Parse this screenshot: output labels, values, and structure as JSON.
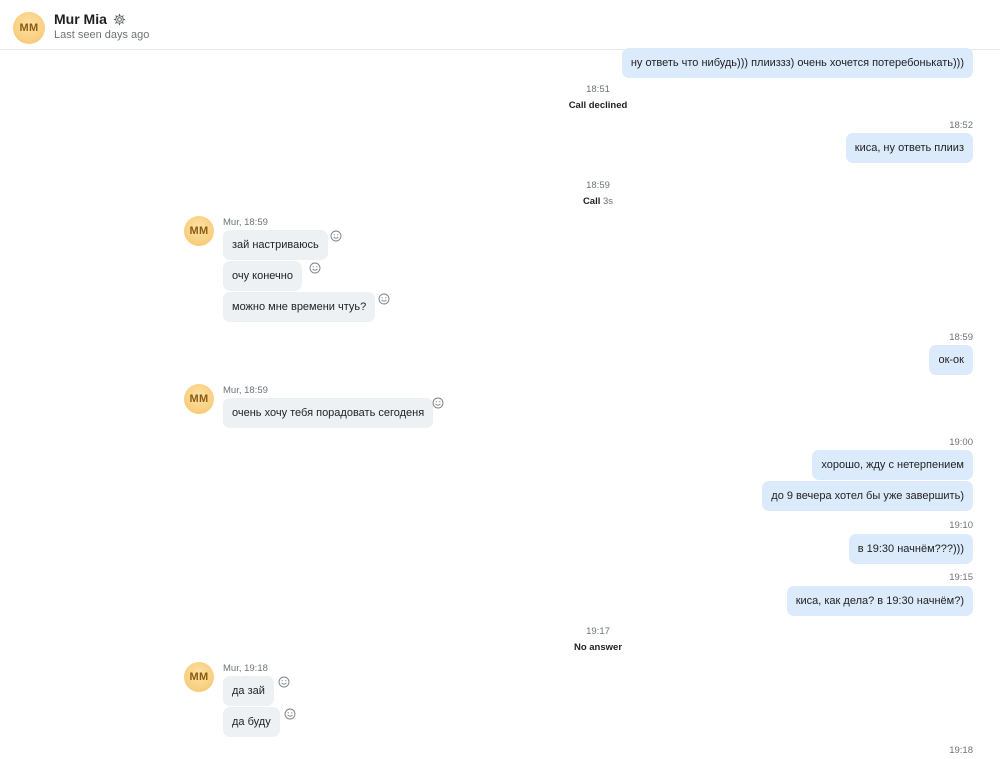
{
  "header": {
    "avatar_initials": "MM",
    "contact_name": "Mur Mia",
    "status": "Last seen days ago"
  },
  "messages": {
    "m0": "ну ответь что нибудь))) плииззз) очень хочется потеребонькать)))",
    "t1851": "18:51",
    "call_declined": "Call declined",
    "t1852": "18:52",
    "m1": "киса, ну ответь плииз",
    "t1859a": "18:59",
    "call": "Call",
    "call_duration": "3s",
    "sender1": "Mur, 18:59",
    "in1": "зай настриваюсь",
    "in2": "очу конечно",
    "in3": "можно мне времени чтуь?",
    "t1859b": "18:59",
    "m2": "ок-ок",
    "sender2": "Mur, 18:59",
    "in4": "очень хочу тебя порадовать сегоденя",
    "t1900": "19:00",
    "m3": "хорошо, жду с нетерпением",
    "m4": "до 9 вечера хотел бы уже завершить)",
    "t1910": "19:10",
    "m5": "в 19:30 начнём???)))",
    "t1915": "19:15",
    "m6": "киса, как дела? в 19:30 начнём?)",
    "t1917": "19:17",
    "no_answer": "No answer",
    "sender3": "Mur, 19:18",
    "in5": "да зай",
    "in6": "да буду",
    "t1918": "19:18",
    "avatar_initials": "MM"
  },
  "icons": {
    "settings": "gear-icon",
    "reaction": "smiley-icon"
  },
  "colors": {
    "outgoing_bubble": "#dcebfb",
    "incoming_bubble": "#eef1f4",
    "avatar": "#f6c46a"
  }
}
